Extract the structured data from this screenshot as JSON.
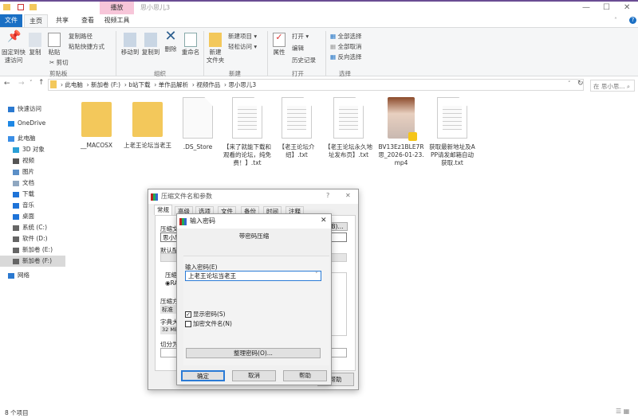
{
  "window": {
    "title": "思小思儿3",
    "context_tab": "播放",
    "minimize": "—",
    "maximize": "☐",
    "close": "✕"
  },
  "tabs": [
    "文件",
    "主页",
    "共享",
    "查看",
    "视频工具"
  ],
  "ribbon": {
    "clipboard": {
      "pin": "固定到快速访问",
      "copy": "复制",
      "paste": "粘贴",
      "copy_path": "复制路径",
      "paste_shortcut": "粘贴快捷方式",
      "cut": "剪切",
      "group": "剪贴板"
    },
    "organize": {
      "move_to": "移动到",
      "copy_to": "复制到",
      "delete": "删除",
      "rename": "重命名",
      "group": "组织"
    },
    "new": {
      "new_folder": "新建\n文件夹",
      "new_item": "新建项目 ▾",
      "easy_access": "轻松访问 ▾",
      "group": "新建"
    },
    "open": {
      "properties": "属性",
      "open": "打开 ▾",
      "edit": "编辑",
      "history": "历史记录",
      "group": "打开"
    },
    "select": {
      "select_all": "全部选择",
      "select_none": "全部取消",
      "invert": "反向选择",
      "group": "选择"
    }
  },
  "address": {
    "crumbs": [
      "此电脑",
      "新加卷 (F:)",
      "b站下载",
      "单作品解析",
      "视频作品",
      "思小思儿3"
    ],
    "search_placeholder": "在 思小思... ⌕"
  },
  "sidebar": [
    {
      "label": "快速访问",
      "color": "#2b79d0"
    },
    {
      "label": "OneDrive",
      "color": "#1e88e5"
    },
    {
      "label": "此电脑",
      "color": "#3a8ee6"
    },
    {
      "label": "3D 对象",
      "color": "#2a9fd6"
    },
    {
      "label": "视频",
      "color": "#555"
    },
    {
      "label": "图片",
      "color": "#5b8fc7"
    },
    {
      "label": "文档",
      "color": "#8fa7c0"
    },
    {
      "label": "下载",
      "color": "#1e73d8"
    },
    {
      "label": "音乐",
      "color": "#1e73d8"
    },
    {
      "label": "桌面",
      "color": "#1e73d8"
    },
    {
      "label": "系统 (C:)",
      "color": "#666"
    },
    {
      "label": "软件 (D:)",
      "color": "#666"
    },
    {
      "label": "新加卷 (E:)",
      "color": "#666"
    },
    {
      "label": "新加卷 (F:)",
      "color": "#666"
    },
    {
      "label": "网络",
      "color": "#2b79d0"
    }
  ],
  "files": [
    {
      "name": "__MACOSX",
      "type": "folder"
    },
    {
      "name": "上老王论坛当老王",
      "type": "folder"
    },
    {
      "name": ".DS_Store",
      "type": "file"
    },
    {
      "name": "【来了就能下载和观看的论坛，纯免费！】.txt",
      "type": "txt"
    },
    {
      "name": "【老王论坛介绍】.txt",
      "type": "txt"
    },
    {
      "name": "【老王论坛永久地址发布页】.txt",
      "type": "txt"
    },
    {
      "name": "BV13Ez1BLE7R思_2026-01-23.mp4",
      "type": "video"
    },
    {
      "name": "获取最新地址及APP请发邮箱自动获取.txt",
      "type": "txt"
    }
  ],
  "status": "8 个项目",
  "archive_dialog": {
    "title": "压缩文件名和参数",
    "help": "?",
    "close": "✕",
    "tabs": [
      "常规",
      "高级",
      "选项",
      "文件",
      "备份",
      "时间",
      "注释"
    ],
    "archive_name_label": "压缩文",
    "archive_name": "思小思",
    "browse": "B)...",
    "profile_label": "默认配",
    "format_label": "压缩",
    "format_rar": "RA",
    "method_label": "压缩方",
    "method": "标准",
    "dict_label": "字典大",
    "dict": "32 MB",
    "split_label": "切分为",
    "help_button": "帮助"
  },
  "password_dialog": {
    "title": "输入密码",
    "close": "✕",
    "heading": "带密码压缩",
    "password_label": "输入密码(E)",
    "password": "上老王论坛当老王",
    "show_password": "显示密码(S)",
    "show_password_checked": true,
    "encrypt_names": "加密文件名(N)",
    "encrypt_names_checked": false,
    "organize": "整理密码(O)...",
    "ok": "确定",
    "cancel": "取消",
    "help": "帮助"
  }
}
